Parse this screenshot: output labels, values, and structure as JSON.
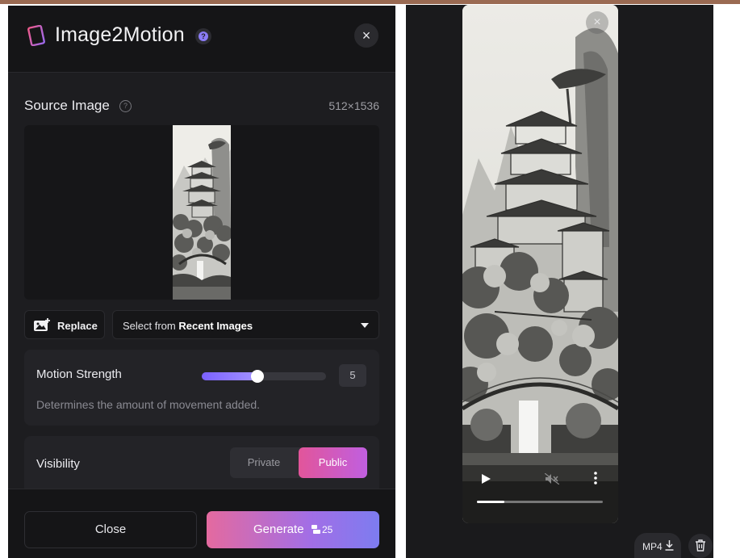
{
  "dialog": {
    "title": "Image2Motion",
    "close_glyph": "×",
    "source": {
      "label": "Source Image",
      "dimensions": "512×1536"
    },
    "replace_label": "Replace",
    "select": {
      "prefix": "Select from ",
      "value": "Recent Images"
    },
    "motion": {
      "label": "Motion Strength",
      "value": "5",
      "fraction": 0.45,
      "description": "Determines the amount of movement added."
    },
    "visibility": {
      "label": "Visibility",
      "options": [
        "Private",
        "Public"
      ],
      "selected": "Public"
    },
    "footer": {
      "close_label": "Close",
      "generate_label": "Generate",
      "cost": "25"
    }
  },
  "preview": {
    "close_glyph": "×",
    "progress_fraction": 0.22,
    "download_label": "MP4"
  },
  "icons": {
    "title": "film-strip-icon",
    "help": "help-icon",
    "replace": "image-add-icon",
    "select": "caret-down-icon",
    "credit": "credit-icon",
    "download": "download-icon",
    "delete": "trash-icon",
    "play": "play-icon",
    "mute": "mute-icon",
    "more": "more-vertical-icon"
  },
  "colors": {
    "accent_pink": "#e2559a",
    "accent_purple": "#7b61ff",
    "panel_bg": "#1d1d20"
  }
}
